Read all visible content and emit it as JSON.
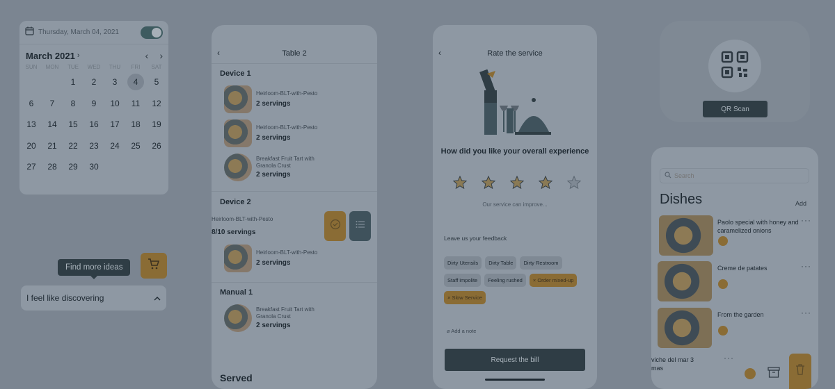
{
  "calendar": {
    "selected_date_text": "Thursday, March 04, 2021",
    "month_label": "March 2021",
    "weekdays": [
      "SUN",
      "MON",
      "TUE",
      "WED",
      "THU",
      "FRI",
      "SAT"
    ],
    "days": [
      "",
      "",
      "1",
      "2",
      "3",
      "4",
      "5",
      "6",
      "7",
      "8",
      "9",
      "10",
      "11",
      "12",
      "13",
      "14",
      "15",
      "16",
      "17",
      "18",
      "19",
      "20",
      "21",
      "22",
      "23",
      "24",
      "25",
      "26",
      "27",
      "28",
      "29",
      "30"
    ],
    "selected_day": "4",
    "toggle_on": true
  },
  "ideas": {
    "tooltip": "Find more ideas",
    "discover_label": "I feel like discovering"
  },
  "table": {
    "title": "Table 2",
    "sections": [
      {
        "name": "Device 1",
        "items": [
          {
            "name": "Heirloom-BLT-with-Pesto",
            "servings": "2 servings"
          },
          {
            "name": "Heirloom-BLT-with-Pesto",
            "servings": "2 servings"
          },
          {
            "name": "Breakfast Fruit Tart with Granola Crust",
            "servings": "2 servings"
          }
        ]
      },
      {
        "name": "Device 2",
        "items": [
          {
            "name": "Heirloom-BLT-with-Pesto",
            "servings": "8/10 servings"
          },
          {
            "name": "Heirloom-BLT-with-Pesto",
            "servings": "2 servings"
          }
        ]
      },
      {
        "name": "Manual 1",
        "items": [
          {
            "name": "Breakfast Fruit Tart with Granola Crust",
            "servings": "2 servings"
          }
        ]
      }
    ],
    "served_label": "Served"
  },
  "rating": {
    "title": "Rate the service",
    "question": "How did you like your overall experience",
    "stars": 5,
    "subtitle": "Our service can improve...",
    "feedback_label": "Leave us your feedback",
    "chips": [
      {
        "label": "Dirty Utensils",
        "selected": false
      },
      {
        "label": "Dirty Table",
        "selected": false
      },
      {
        "label": "Dirty Restroom",
        "selected": false
      },
      {
        "label": "Staff impolite",
        "selected": false
      },
      {
        "label": "Feeling rushed",
        "selected": false
      },
      {
        "label": "Order mixed-up",
        "selected": true
      },
      {
        "label": "Slow Service",
        "selected": true
      }
    ],
    "add_note": "Add a note",
    "bill_button": "Request the bill"
  },
  "qr": {
    "label": "QR Scan"
  },
  "dishes": {
    "search_placeholder": "Search",
    "title": "Dishes",
    "add_label": "Add",
    "items": [
      {
        "name": "Paolo special with honey and caramelized onions"
      },
      {
        "name": "Creme de patates"
      },
      {
        "name": "From the garden"
      }
    ],
    "partial_item": "viche del mar 3\nmas",
    "colors": {
      "accent": "#8a6c35",
      "dark": "#2f3d45",
      "overlay_bg": "#7b8591"
    }
  }
}
